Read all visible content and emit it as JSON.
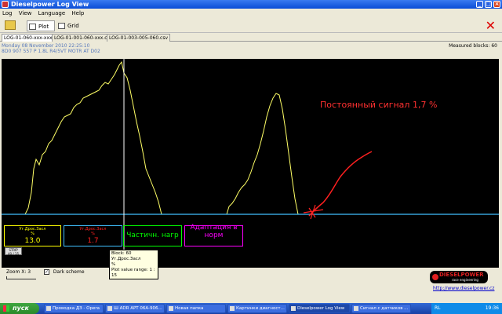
{
  "window": {
    "title": "Dieselpower Log View"
  },
  "menu": [
    "Log",
    "View",
    "Language",
    "Help"
  ],
  "toolbar": {
    "plot_label": "Plot",
    "grid_label": "Grid"
  },
  "file_tabs": [
    "LOG-01-060-xxx-xxx.csv",
    "LOG-01-001-060-xxx.csv",
    "LOG-01-003-005-060.csv"
  ],
  "info": {
    "date": "Monday 08 November 2010 22:25:10",
    "vehicle": "8D0 907 557 P  1.8L R4/5VT MOTR AT D02"
  },
  "measured_blocks": "Measured blocks: 60",
  "annotation": "Постоянный сигнал 1,7 %",
  "value_boxes": [
    {
      "label": "Уг.Дрос.Засл",
      "unit": "%",
      "value": "13.0",
      "color": "#ffff00"
    },
    {
      "label": "Уг.Дрос.Засл",
      "unit": "%",
      "value": "1.7",
      "color": "#ff2020"
    },
    {
      "label": "",
      "unit": "",
      "value": "Частичн. нагр",
      "color": "#00ff00"
    },
    {
      "label": "",
      "unit": "",
      "value": "Адаптация в норм",
      "color": "#ff00ff"
    }
  ],
  "tooltip": {
    "block": "Block: 60",
    "name": "Уг.Дрос.Засл",
    "unit": "%",
    "range": "Plot value range: 1 : 15"
  },
  "strip": {
    "label": "STRIP",
    "value": "40 / 15"
  },
  "zoom": {
    "label": "Zoom X: 3"
  },
  "dark_scheme": {
    "label": "Dark scheme",
    "checked": true
  },
  "logo": {
    "name": "DIESELPOWER",
    "tagline": "race engineering",
    "url": "http://www.dieselpower.cz"
  },
  "taskbar": {
    "start": "пуск",
    "tasks": [
      "Проводка ДЗ - Opera",
      "Ш ADR APT 06A-906...",
      "Новая папка",
      "Картинки диагност...",
      "Dieselpower Log View",
      "Сигнал с датчиков ..."
    ],
    "lang": "RL",
    "clock": "19:36"
  },
  "colors": {
    "trace": "#ffff66",
    "baseline": "#40c0ff",
    "cursor": "#ffffff",
    "annotation": "#ff3030"
  }
}
